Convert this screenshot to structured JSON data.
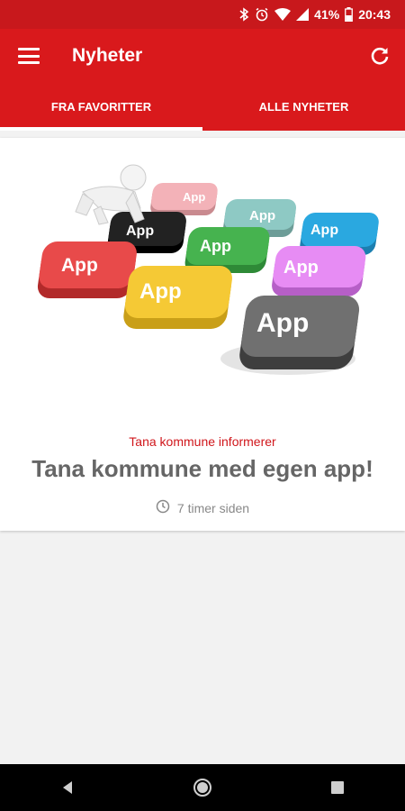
{
  "status_bar": {
    "battery_percent": "41%",
    "time": "20:43",
    "icons": [
      "bluetooth-icon",
      "alarm-icon",
      "wifi-icon",
      "signal-icon",
      "battery-icon"
    ]
  },
  "app_bar": {
    "title": "Nyheter",
    "menu_icon": "menu-icon",
    "refresh_icon": "refresh-icon"
  },
  "tabs": [
    {
      "label": "FRA FAVORITTER",
      "active": true
    },
    {
      "label": "ALLE NYHETER",
      "active": false
    }
  ],
  "article": {
    "tiles": [
      "App",
      "App",
      "App",
      "App",
      "App",
      "App",
      "App",
      "App",
      "App"
    ],
    "category": "Tana kommune informerer",
    "headline": "Tana kommune med egen app!",
    "timestamp": "7 timer siden"
  },
  "colors": {
    "primary": "#d9191c",
    "status_bar": "#c8181c",
    "category_text": "#d0161b"
  }
}
